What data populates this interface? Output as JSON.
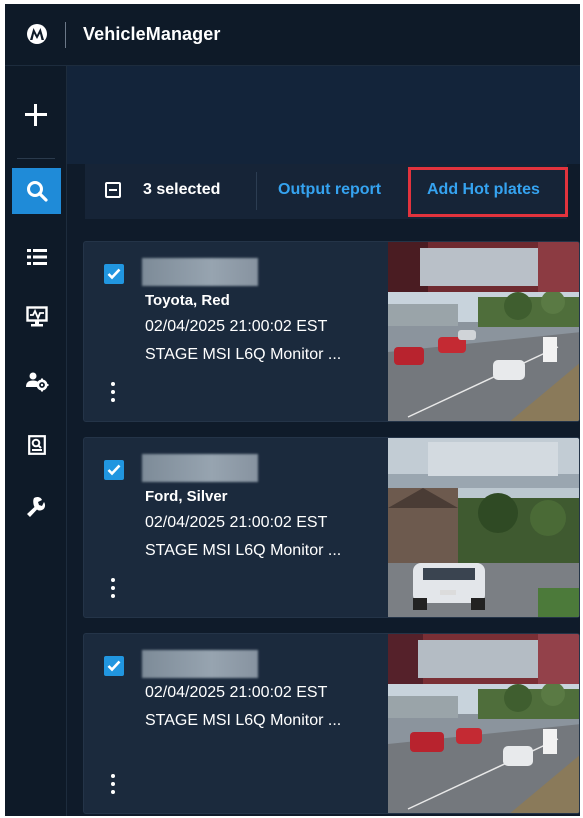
{
  "app": {
    "title": "VehicleManager",
    "brand_icon": "motorola-logo-icon"
  },
  "rail": {
    "items": [
      {
        "name": "search",
        "icon": "search-icon",
        "active": true
      },
      {
        "name": "list",
        "icon": "list-icon",
        "active": false
      },
      {
        "name": "monitor",
        "icon": "monitor-icon",
        "active": false
      },
      {
        "name": "users-settings",
        "icon": "users-gear-icon",
        "active": false
      },
      {
        "name": "report",
        "icon": "report-search-icon",
        "active": false
      },
      {
        "name": "tools",
        "icon": "wrench-icon",
        "active": false
      }
    ]
  },
  "toolbar": {
    "selected_label": "3 selected",
    "output_report_label": "Output report",
    "add_hot_plates_label": "Add Hot plates"
  },
  "results": [
    {
      "checked": true,
      "vehicle": "Toyota, Red",
      "timestamp": "02/04/2025 21:00:02 EST",
      "camera": "STAGE MSI L6Q Monitor ..."
    },
    {
      "checked": true,
      "vehicle": "Ford, Silver",
      "timestamp": "02/04/2025 21:00:02 EST",
      "camera": "STAGE MSI L6Q Monitor ..."
    },
    {
      "checked": true,
      "vehicle": "",
      "timestamp": "02/04/2025 21:00:02 EST",
      "camera": "STAGE MSI L6Q Monitor ..."
    }
  ],
  "colors": {
    "accent": "#1f8bd8",
    "link": "#35a3f0",
    "highlight": "#e2333d",
    "background": "#0f1b2a",
    "card": "#1b2a3d"
  }
}
